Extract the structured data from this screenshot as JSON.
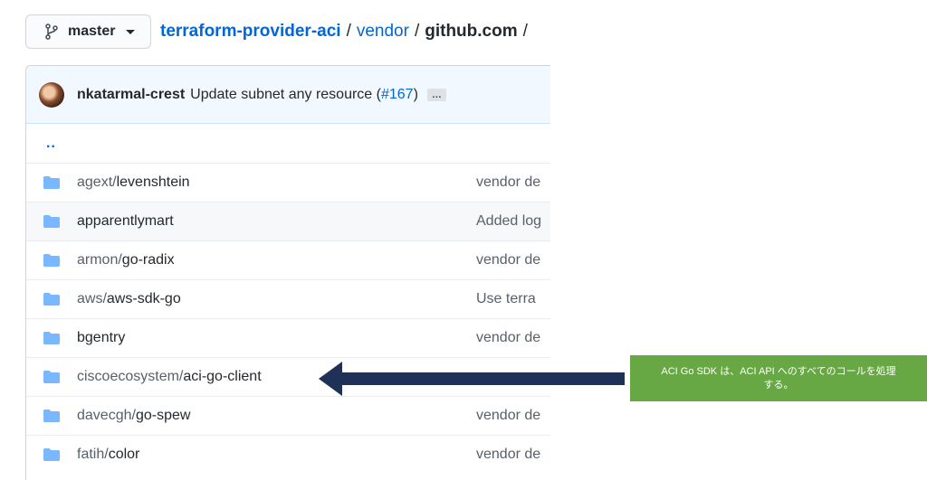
{
  "header": {
    "branch_label": "master",
    "breadcrumb": {
      "repo": "terraform-provider-aci",
      "folder": "vendor",
      "current": "github.com",
      "separator": "/"
    }
  },
  "commit": {
    "author": "nkatarmal-crest",
    "message": "Update subnet any resource (",
    "pr_link": "#167",
    "message_end": ")",
    "ellipsis": "…"
  },
  "files": {
    "parent_link": "..",
    "rows": [
      {
        "prefix": "agext/",
        "name": "levenshtein",
        "commit": "vendor de"
      },
      {
        "prefix": "",
        "name": "apparentlymart",
        "commit": "Added log"
      },
      {
        "prefix": "armon/",
        "name": "go-radix",
        "commit": "vendor de"
      },
      {
        "prefix": "aws/",
        "name": "aws-sdk-go",
        "commit": "Use terra"
      },
      {
        "prefix": "",
        "name": "bgentry",
        "commit": "vendor de"
      },
      {
        "prefix": "ciscoecosystem/",
        "name": "aci-go-client",
        "commit": ""
      },
      {
        "prefix": "davecgh/",
        "name": "go-spew",
        "commit": "vendor de"
      },
      {
        "prefix": "fatih/",
        "name": "color",
        "commit": "vendor de"
      }
    ]
  },
  "annotation": {
    "text": "ACI Go SDK は、ACI API へのすべてのコールを処理する。",
    "color": "#67a844",
    "arrow_color": "#1f3156"
  },
  "icons": {
    "branch": "git-branch-icon",
    "folder": "folder-icon"
  }
}
